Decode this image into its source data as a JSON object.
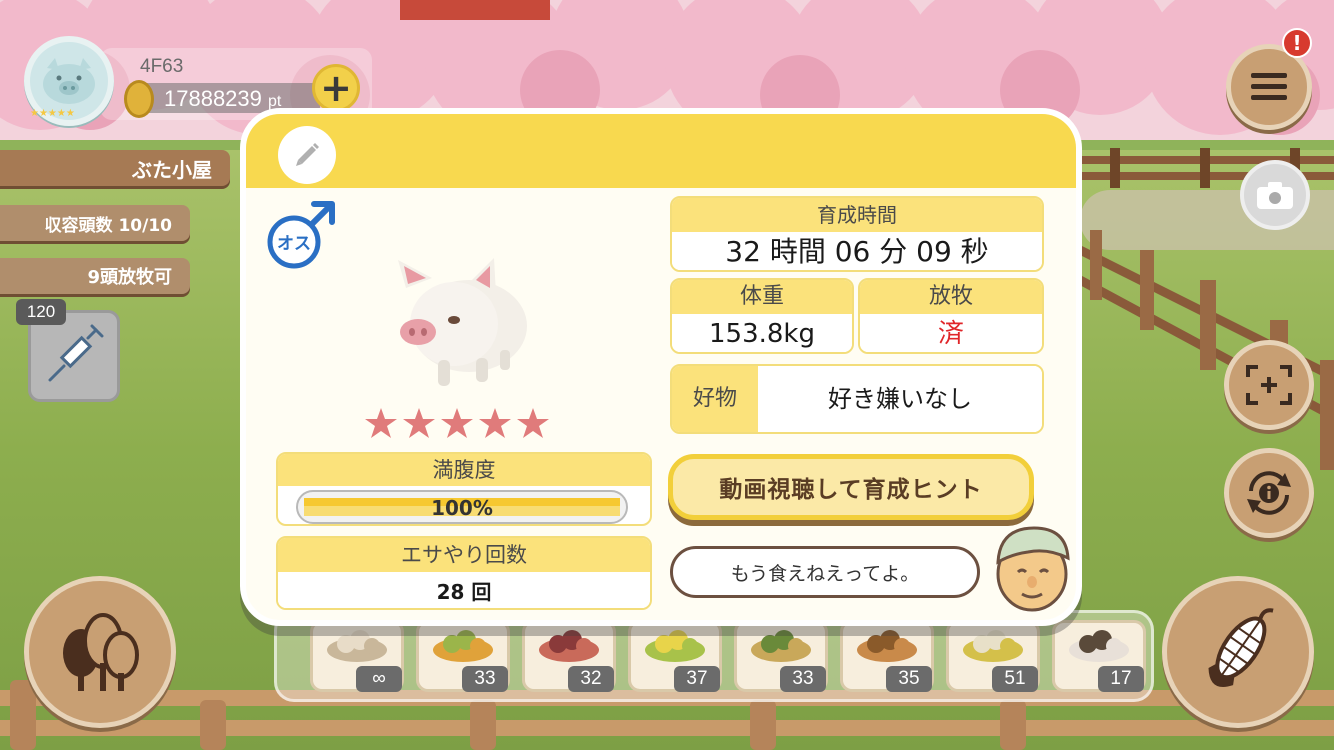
{
  "player": {
    "id": "4F63",
    "points": "17888239",
    "points_unit": "pt",
    "avatar_stars": "★★★★★"
  },
  "hud": {
    "plus_label": "+",
    "house_label": "ぶた小屋",
    "capacity_label": "収容頭数 10/10",
    "release_label": "9頭放牧可",
    "item_count": "120",
    "alert_badge": "!"
  },
  "modal": {
    "gender_label": "オス",
    "star_rating": 5,
    "fullness": {
      "caption": "満腹度",
      "value_text": "100%",
      "value": 1.0
    },
    "feed_count": {
      "caption": "エサやり回数",
      "value": "28 回"
    },
    "raising_time": {
      "caption": "育成時間",
      "value": "32 時間 06 分 09 秒"
    },
    "weight": {
      "caption": "体重",
      "value": "153.8kg"
    },
    "grazing": {
      "caption": "放牧",
      "value": "済"
    },
    "favorite": {
      "caption": "好物",
      "value": "好き嫌いなし"
    },
    "hint_button": "動画視聴して育成ヒント",
    "farmer_speech": "もう食えねえってよ。"
  },
  "feed_tray": [
    {
      "name": "mixed-grain",
      "count": "∞"
    },
    {
      "name": "vegetable-mix",
      "count": "33"
    },
    {
      "name": "sweet-potato",
      "count": "32"
    },
    {
      "name": "corn",
      "count": "37"
    },
    {
      "name": "sprout-beans",
      "count": "33"
    },
    {
      "name": "acorns",
      "count": "35"
    },
    {
      "name": "salad-plate",
      "count": "51"
    },
    {
      "name": "truffle-plate",
      "count": "17"
    }
  ],
  "colors": {
    "header_yellow": "#f8d94f",
    "caption_yellow": "#fbe27b",
    "graze_red": "#e0262a",
    "gender_blue": "#2a6fc4",
    "star_pink": "#e07b7b"
  }
}
